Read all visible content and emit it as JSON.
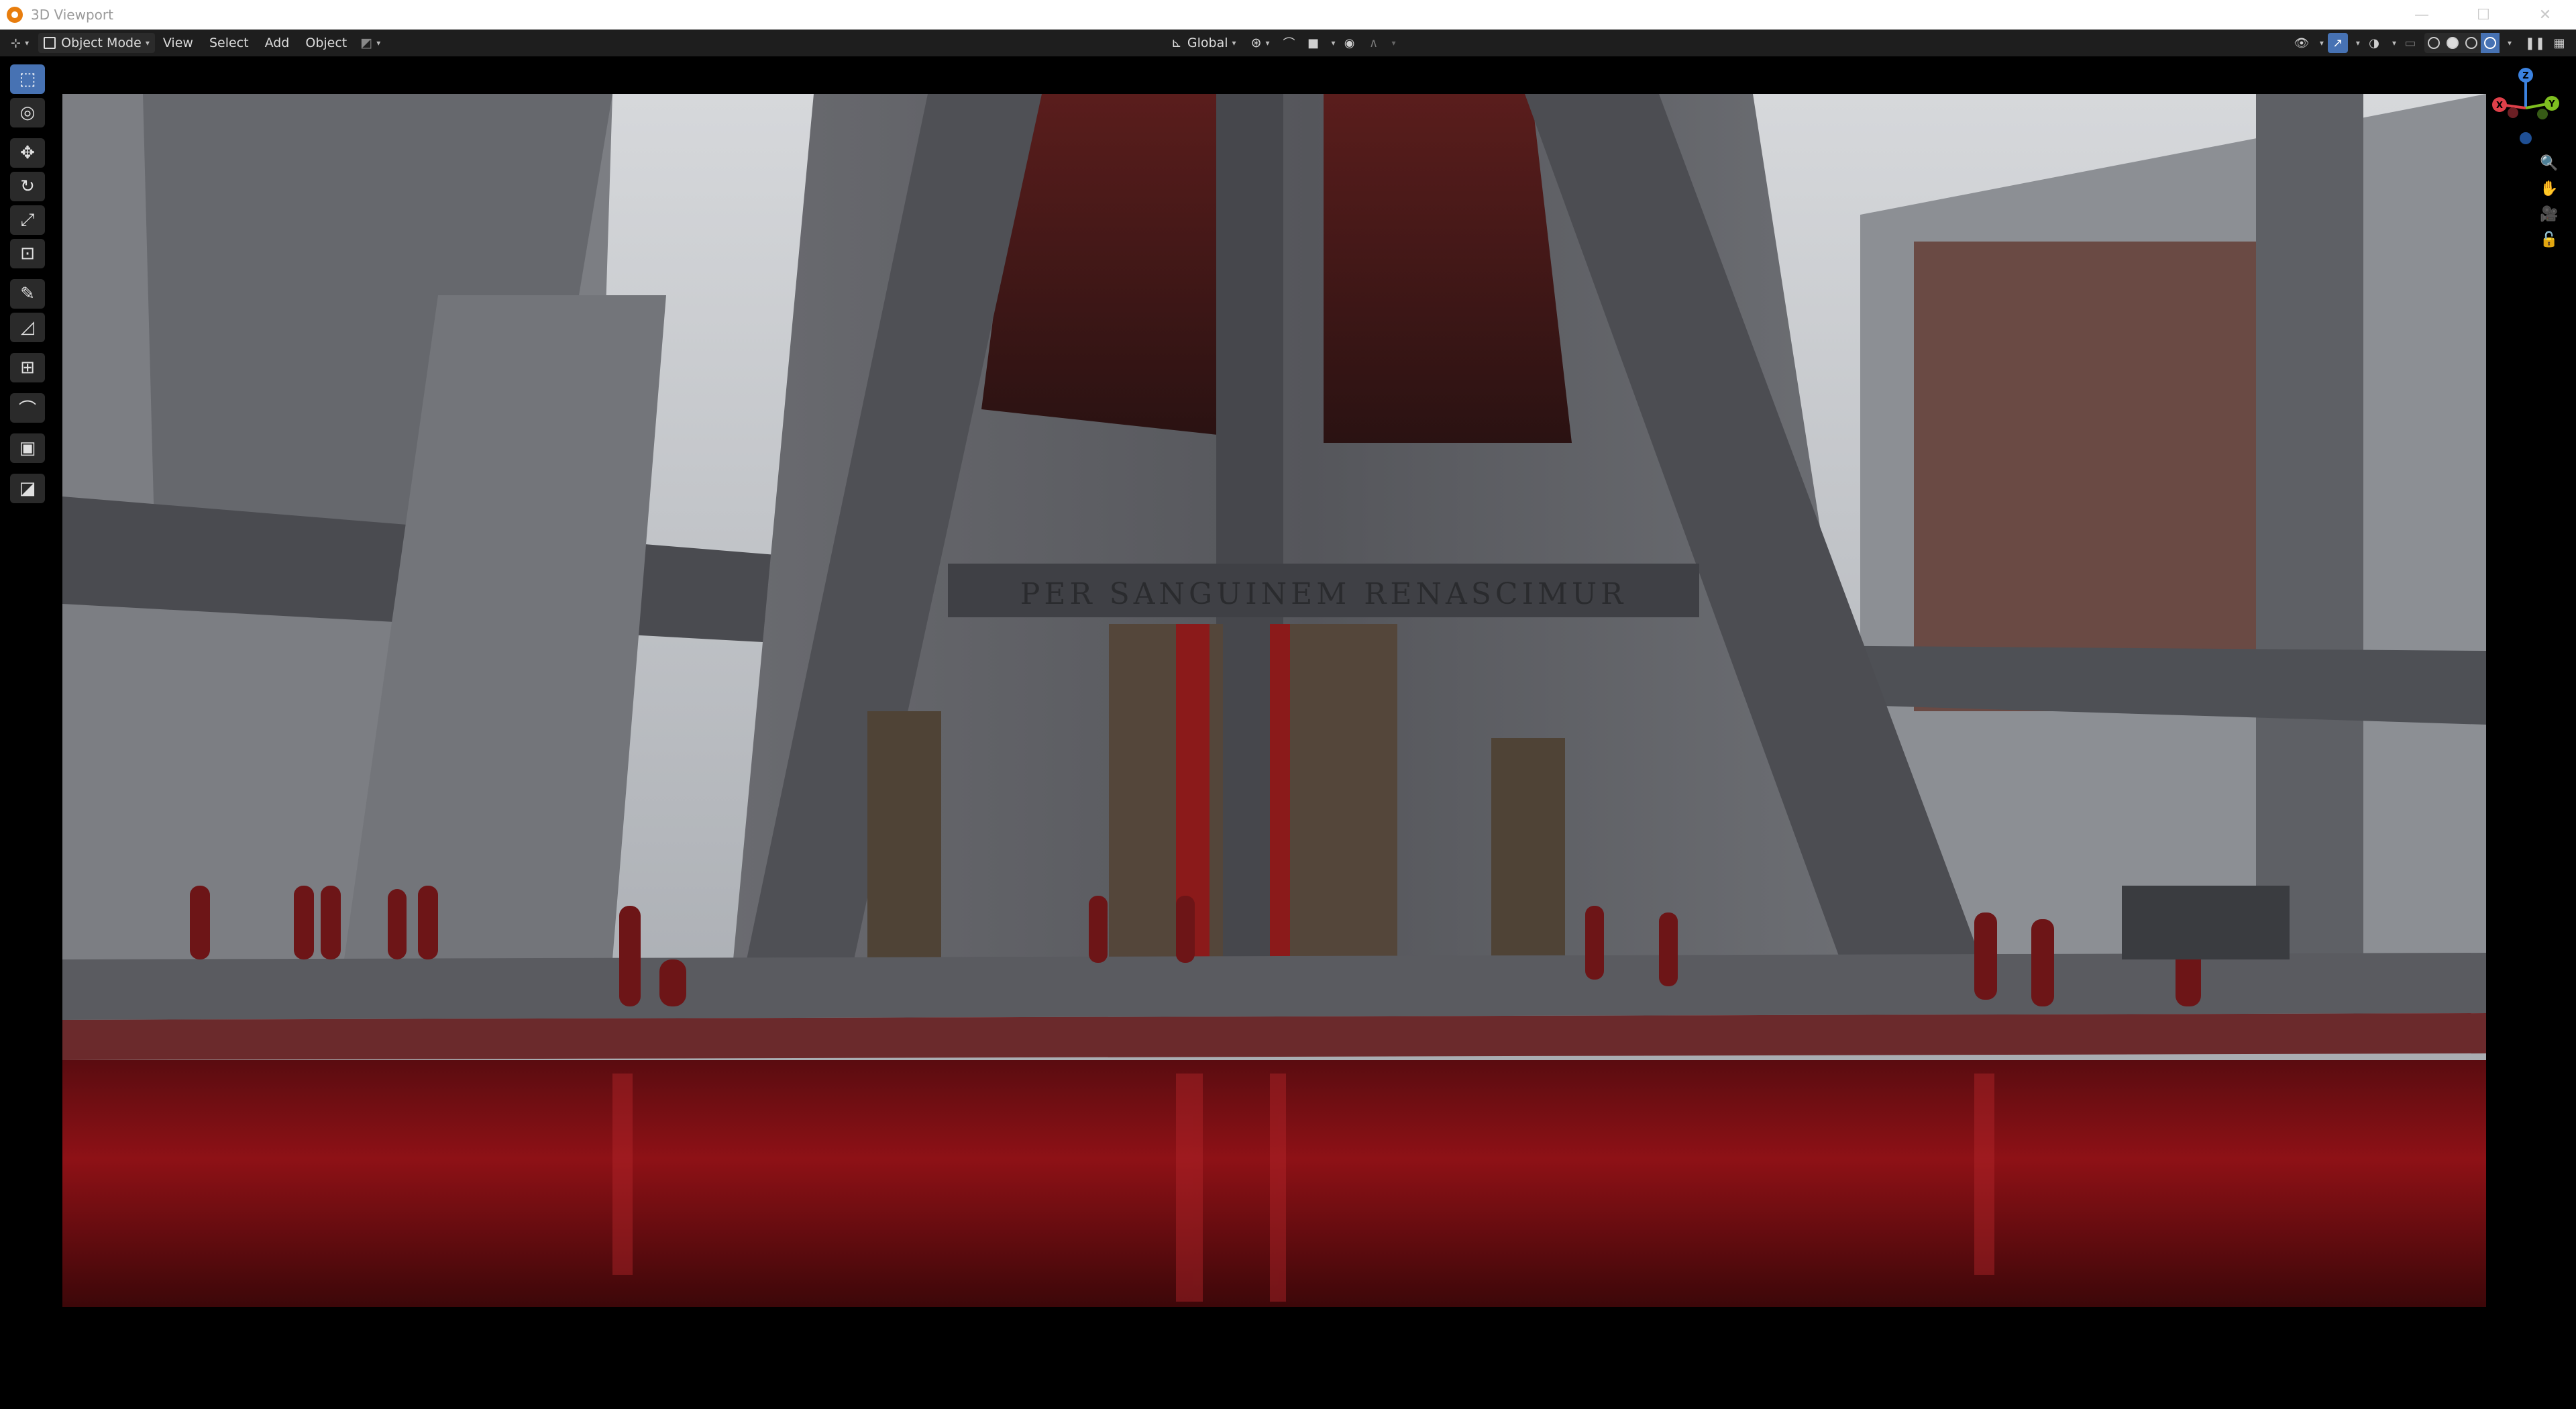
{
  "window": {
    "title": "3D Viewport",
    "controls": [
      "—",
      "☐",
      "✕"
    ]
  },
  "header": {
    "editor_type_icon": "editor-type-icon",
    "mode": "Object Mode",
    "menus": [
      "View",
      "Select",
      "Add",
      "Object"
    ],
    "transform_orientation": "Global"
  },
  "toolbar": {
    "tools": [
      {
        "name": "select-box-tool",
        "glyph": "⬚",
        "active": true
      },
      {
        "name": "cursor-tool",
        "glyph": "◎",
        "active": false
      },
      {
        "name": "move-tool",
        "glyph": "✥",
        "active": false
      },
      {
        "name": "rotate-tool",
        "glyph": "↻",
        "active": false
      },
      {
        "name": "scale-tool",
        "glyph": "⤢",
        "active": false
      },
      {
        "name": "transform-tool",
        "glyph": "⊡",
        "active": false
      },
      {
        "name": "annotate-tool",
        "glyph": "✎",
        "active": false
      },
      {
        "name": "measure-tool",
        "glyph": "📐",
        "active": false
      },
      {
        "name": "add-cube-tool",
        "glyph": "⊞",
        "active": false
      },
      {
        "name": "curve-tool",
        "glyph": "⌒",
        "active": false
      },
      {
        "name": "add-image-tool",
        "glyph": "▣",
        "active": false
      },
      {
        "name": "draw-tool",
        "glyph": "◪",
        "active": false
      }
    ]
  },
  "gizmo": {
    "axes": {
      "x": "X",
      "y": "Y",
      "z": "Z"
    },
    "colors": {
      "x": "#e0404a",
      "y": "#7fbf20",
      "z": "#3b82e0"
    }
  },
  "render": {
    "inscription": "PER SANGUINEM RENASCIMUR",
    "colors": {
      "blood": "#8e1116",
      "sky": "#c9ccd0",
      "concrete": "#5f6064"
    }
  }
}
